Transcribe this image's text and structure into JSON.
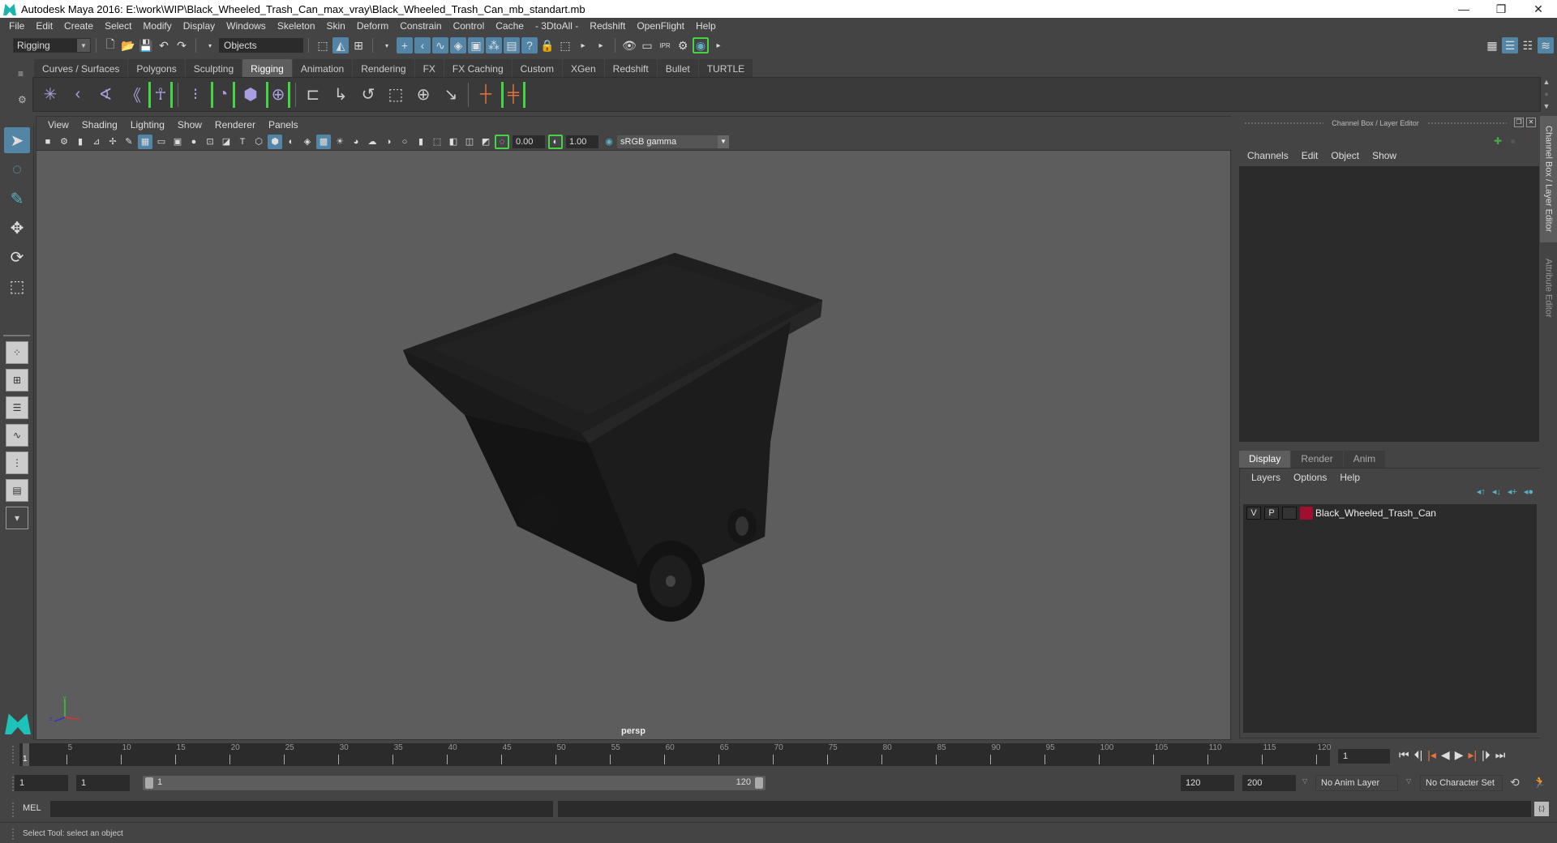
{
  "title": "Autodesk Maya 2016: E:\\work\\WIP\\Black_Wheeled_Trash_Can_max_vray\\Black_Wheeled_Trash_Can_mb_standart.mb",
  "window_controls": {
    "minimize": "—",
    "restore": "❐",
    "close": "✕"
  },
  "menubar": [
    "File",
    "Edit",
    "Create",
    "Select",
    "Modify",
    "Display",
    "Windows",
    "Skeleton",
    "Skin",
    "Deform",
    "Constrain",
    "Control",
    "Cache",
    "- 3DtoAll -",
    "Redshift",
    "OpenFlight",
    "Help"
  ],
  "status_line": {
    "mode": "Rigging",
    "selection_mask": "Objects"
  },
  "shelf": {
    "tabs": [
      "Curves / Surfaces",
      "Polygons",
      "Sculpting",
      "Rigging",
      "Animation",
      "Rendering",
      "FX",
      "FX Caching",
      "Custom",
      "XGen",
      "Redshift",
      "Bullet",
      "TURTLE"
    ],
    "active_tab": "Rigging"
  },
  "viewport": {
    "menu": [
      "View",
      "Shading",
      "Lighting",
      "Show",
      "Renderer",
      "Panels"
    ],
    "exposure": "0.00",
    "gamma": "1.00",
    "color_space": "sRGB gamma",
    "camera_label": "persp",
    "axis": {
      "x": "x",
      "y": "y",
      "z": "z"
    }
  },
  "channel_box": {
    "title": "Channel Box / Layer Editor",
    "menu": [
      "Channels",
      "Edit",
      "Object",
      "Show"
    ]
  },
  "layer_editor": {
    "tabs": [
      "Display",
      "Render",
      "Anim"
    ],
    "active_tab": "Display",
    "menu": [
      "Layers",
      "Options",
      "Help"
    ],
    "layers": [
      {
        "visible": "V",
        "playback": "P",
        "color": "#a0102e",
        "name": "Black_Wheeled_Trash_Can"
      }
    ]
  },
  "side_tabs": [
    "Channel Box / Layer Editor",
    "Attribute Editor"
  ],
  "time_slider": {
    "ticks": [
      "5",
      "10",
      "15",
      "20",
      "25",
      "30",
      "35",
      "40",
      "45",
      "50",
      "55",
      "60",
      "65",
      "70",
      "75",
      "80",
      "85",
      "90",
      "95",
      "100",
      "105",
      "110",
      "115",
      "120"
    ],
    "current_frame_marker": "1",
    "current_frame": "1",
    "start": 1,
    "end": 120
  },
  "range_slider": {
    "start_time": "1",
    "playback_start": "1",
    "range_start_label": "1",
    "range_end_label": "120",
    "playback_end": "120",
    "end_time": "200",
    "anim_layer": "No Anim Layer",
    "character_set": "No Character Set"
  },
  "command_line": {
    "label": "MEL"
  },
  "help_line": "Select Tool: select an object",
  "colors": {
    "accent_blue": "#5285a6",
    "highlight_green": "#44d444",
    "maya_teal": "#1fc2b9",
    "orange": "#e8743b",
    "viewport_bg": "#5d5d5d"
  }
}
